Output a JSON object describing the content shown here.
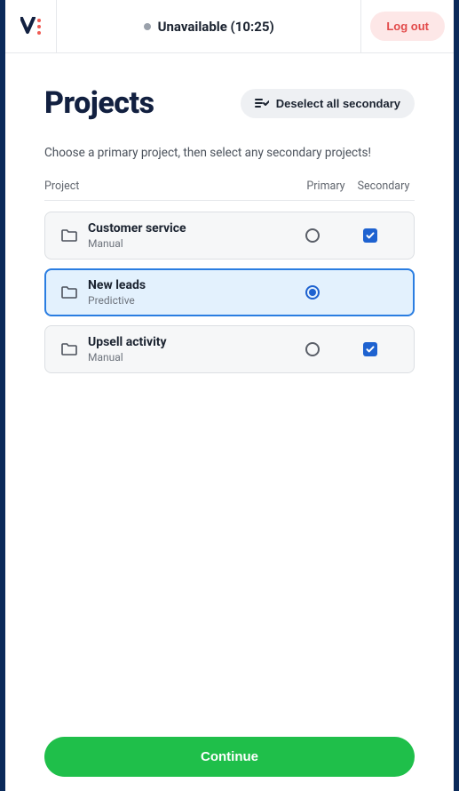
{
  "header": {
    "status_text": "Unavailable (10:25)",
    "logout_label": "Log out"
  },
  "page": {
    "title": "Projects",
    "deselect_label": "Deselect all secondary",
    "subtitle": "Choose a primary project, then select any secondary projects!"
  },
  "columns": {
    "project": "Project",
    "primary": "Primary",
    "secondary": "Secondary"
  },
  "projects": [
    {
      "name": "Customer service",
      "type": "Manual",
      "primary": false,
      "secondary": true
    },
    {
      "name": "New leads",
      "type": "Predictive",
      "primary": true,
      "secondary": false
    },
    {
      "name": "Upsell activity",
      "type": "Manual",
      "primary": false,
      "secondary": true
    }
  ],
  "footer": {
    "continue_label": "Continue"
  }
}
